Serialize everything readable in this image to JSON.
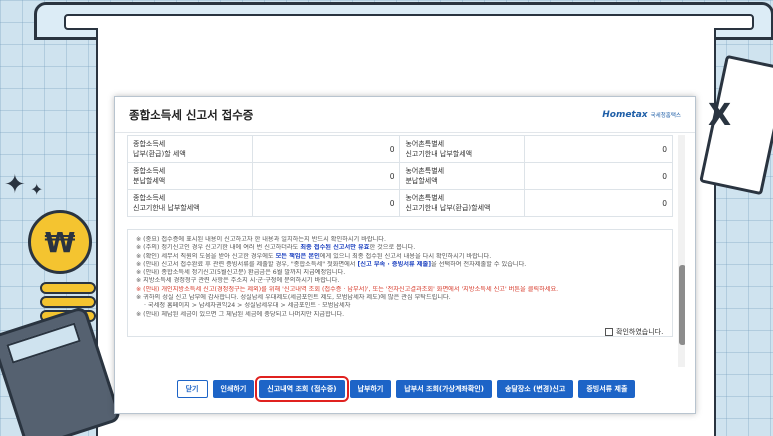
{
  "dialog": {
    "title": "종합소득세 신고서 접수증",
    "logo": {
      "mark": "Hometax",
      "sub": "국세청홈택스"
    }
  },
  "amounts": [
    {
      "left_label": [
        "종합소득세",
        "납부(환급)할 세액"
      ],
      "left_value": "0",
      "right_label": [
        "농어촌특별세",
        "신고기한내 납부할세액"
      ],
      "right_value": "0"
    },
    {
      "left_label": [
        "종합소득세",
        "분납할세액"
      ],
      "left_value": "0",
      "right_label": [
        "농어촌특별세",
        "분납할세액"
      ],
      "right_value": "0"
    },
    {
      "left_label": [
        "종합소득세",
        "신고기한내 납부할세액"
      ],
      "left_value": "0",
      "right_label": [
        "농어촌특별세",
        "신고기한내 납부(환급)할세액"
      ],
      "right_value": "0"
    }
  ],
  "notices": [
    {
      "segments": [
        {
          "t": "※ (중요) 접수증에 표시된 내용이 신고하고자 한 내용과 일치하는지 반드시 확인하시기 바랍니다."
        }
      ]
    },
    {
      "segments": [
        {
          "t": "※ (주의) 정기신고인 경우 신고기한 내에 여러 번 신고하더라도 "
        },
        {
          "t": "최종 접수된 신고서만 유효",
          "c": "hl-blue"
        },
        {
          "t": "한 것으로 봅니다."
        }
      ]
    },
    {
      "segments": [
        {
          "t": "※ (확인) 세무서 직원의 도움을 받아 신고한 경우에도 "
        },
        {
          "t": "모든 책임은 본인",
          "c": "hl-blue"
        },
        {
          "t": "에게 있으니 최종 접수된 신고서 내용을 다시 확인하시기 바랍니다."
        }
      ]
    },
    {
      "segments": [
        {
          "t": "※ (안내) 신고서 접수완료 후 관련 증빙서류를 제출할 경우, \"종합소득세\" 첫화면에서 "
        },
        {
          "t": "[신고 부속 · 증빙서류 제출]",
          "c": "hl-blue"
        },
        {
          "t": "을 선택하여 전자제출할 수 있습니다."
        }
      ]
    },
    {
      "segments": [
        {
          "t": "※ (안내) 종합소득세 정기신고(5월신고분) 환급금은 6월 말까지 지급예정입니다."
        }
      ]
    },
    {
      "segments": [
        {
          "t": "※ 지방소득세 경정청구 관련 사항은 주소지 시·군·구청에 문의하시기 바랍니다."
        }
      ]
    },
    {
      "segments": [
        {
          "t": "※ (안내) 개인지방소득세 신고(경정청구는 제외)를 위해 '신고내역 조회 (접수증 · 납부서)', 또는 '전자신고결과조회' 화면에서 '지방소득세 신고' 버튼을 클릭하세요.",
          "c": "hl-red"
        }
      ]
    },
    {
      "segments": [
        {
          "t": "※ 귀하의 성실 신고 납부에 감사합니다. 성실납세 우대제도(세금포인트 제도, 모범납세자 제도)에 많은 관심 부탁드립니다."
        }
      ]
    },
    {
      "segments": [
        {
          "t": "· 국세청 홈페이지 > 납세자권익24 > 성실납세우대 > 세금포인트 · 모범납세자"
        }
      ],
      "indent": true
    },
    {
      "segments": [
        {
          "t": "※ (안내) 체납된 세금이 있으면 그 체납된 세금에 충당되고 나머지만 지급합니다."
        }
      ]
    }
  ],
  "confirm_label": "확인하였습니다.",
  "buttons": [
    {
      "label": "닫기",
      "style": "outline"
    },
    {
      "label": "인쇄하기",
      "style": "solid"
    },
    {
      "label": "신고내역 조회 (접수증)",
      "style": "solid",
      "highlighted": true
    },
    {
      "label": "납부하기",
      "style": "solid"
    },
    {
      "label": "납부서 조회(가상계좌확인)",
      "style": "solid"
    },
    {
      "label": "송달장소 (변경)신고",
      "style": "solid"
    },
    {
      "label": "증빙서류 제출",
      "style": "solid"
    }
  ],
  "decor": {
    "coin_symbol": "₩",
    "receipt_mark": "X"
  },
  "colors": {
    "accent": "#1d64c7",
    "highlight_box": "#e0211f",
    "notice_blue": "#1a3fbf",
    "notice_red": "#d63a2b"
  }
}
